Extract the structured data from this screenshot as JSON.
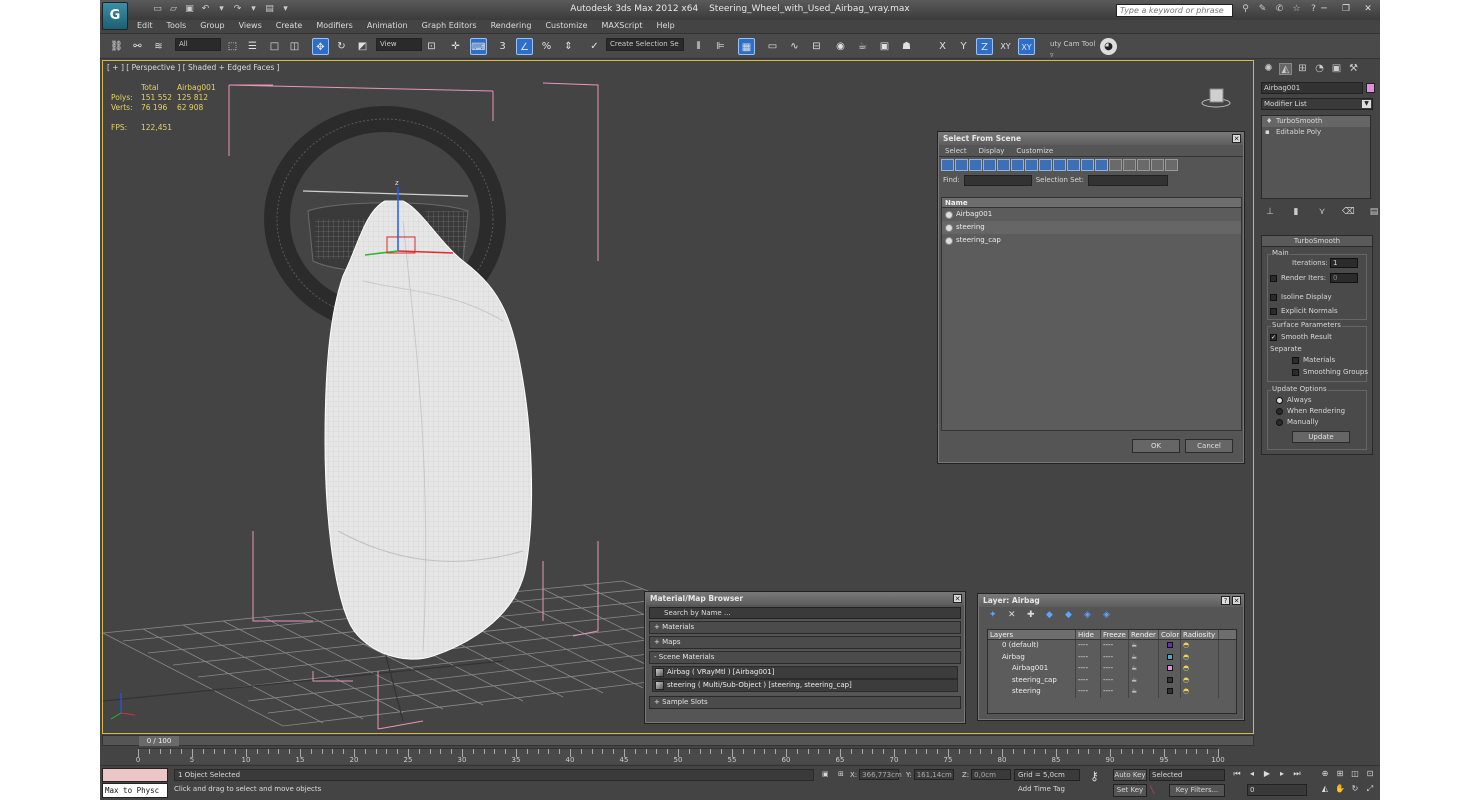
{
  "title": {
    "app": "Autodesk 3ds Max  2012 x64",
    "file": "Steering_Wheel_with_Used_Airbag_vray.max"
  },
  "search_placeholder": "Type a keyword or phrase",
  "menu": [
    "Edit",
    "Tools",
    "Group",
    "Views",
    "Create",
    "Modifiers",
    "Animation",
    "Graph Editors",
    "Rendering",
    "Customize",
    "MAXScript",
    "Help"
  ],
  "toolbar": {
    "filter": "All",
    "refcoord": "View",
    "named_sel": "Create Selection Se",
    "axes": [
      "X",
      "Y",
      "Z",
      "XY"
    ],
    "snap_label": "3",
    "custom": "uty Cam Tool ▿"
  },
  "viewport": {
    "label": "[ + ] [ Perspective ] [ Shaded + Edged Faces ]",
    "stats": {
      "h_total": "Total",
      "h_obj": "Airbag001",
      "polys_label": "Polys:",
      "polys_total": "151 552",
      "polys_obj": "125 812",
      "verts_label": "Verts:",
      "verts_total": "76 196",
      "verts_obj": "62 908",
      "fps_label": "FPS:",
      "fps": "122,451"
    }
  },
  "select_from_scene": {
    "title": "Select From Scene",
    "menu": [
      "Select",
      "Display",
      "Customize"
    ],
    "find_label": "Find:",
    "selset_label": "Selection Set:",
    "col_name": "Name",
    "items": [
      "Airbag001",
      "steering",
      "steering_cap"
    ],
    "ok": "OK",
    "cancel": "Cancel"
  },
  "material_browser": {
    "title": "Material/Map Browser",
    "search": "Search by Name ...",
    "sections": [
      "+ Materials",
      "+ Maps",
      "- Scene Materials",
      "+ Sample Slots"
    ],
    "scene_items": [
      "Airbag  ( VRayMtl )  [Airbag001]",
      "steering  ( Multi/Sub-Object )  [steering, steering_cap]"
    ]
  },
  "layer_dialog": {
    "title": "Layer: Airbag",
    "cols": [
      "Layers",
      "Hide",
      "Freeze",
      "Render",
      "Color",
      "Radiosity"
    ],
    "rows": [
      {
        "name": "0 (default)",
        "hide": "----",
        "freeze": "----",
        "color": "#6a2fb0"
      },
      {
        "name": "Airbag",
        "hide": "----",
        "freeze": "----",
        "color": "#4fa8c8"
      },
      {
        "name": "Airbag001",
        "hide": "----",
        "freeze": "----",
        "color": "#e28ce2"
      },
      {
        "name": "steering_cap",
        "hide": "----",
        "freeze": "----",
        "color": "#333333"
      },
      {
        "name": "steering",
        "hide": "----",
        "freeze": "----",
        "color": "#333333"
      }
    ]
  },
  "command_panel": {
    "object_name": "Airbag001",
    "modifier_list": "Modifier List",
    "stack": [
      "TurboSmooth",
      "Editable Poly"
    ],
    "rollout": "TurboSmooth",
    "main": "Main",
    "iterations_label": "Iterations:",
    "iterations": "1",
    "render_iters_label": "Render Iters:",
    "render_iters": "0",
    "isoline": "Isoline Display",
    "explicit": "Explicit Normals",
    "surface": "Surface Parameters",
    "smooth_result": "Smooth Result",
    "separate": "Separate",
    "materials": "Materials",
    "smoothing": "Smoothing Groups",
    "update_opts": "Update Options",
    "always": "Always",
    "when_rendering": "When Rendering",
    "manually": "Manually",
    "update": "Update"
  },
  "timeline": {
    "frame": "0 / 100",
    "ticks": [
      "0",
      "5",
      "10",
      "15",
      "20",
      "25",
      "30",
      "35",
      "40",
      "45",
      "50",
      "55",
      "60",
      "65",
      "70",
      "75",
      "80",
      "85",
      "90",
      "95",
      "100"
    ]
  },
  "status": {
    "maxscript": "Max to Physc",
    "selected": "1 Object Selected",
    "prompt": "Click and drag to select and move objects",
    "x_label": "X:",
    "x": "366,773cm",
    "y_label": "Y:",
    "y": "161,14cm",
    "z_label": "Z:",
    "z": "0,0cm",
    "grid": "Grid = 5,0cm",
    "auto_key": "Auto Key",
    "set_key": "Set Key",
    "selected_drop": "Selected",
    "key_filters": "Key Filters...",
    "add_time_tag": "Add Time Tag",
    "frame": "0"
  }
}
